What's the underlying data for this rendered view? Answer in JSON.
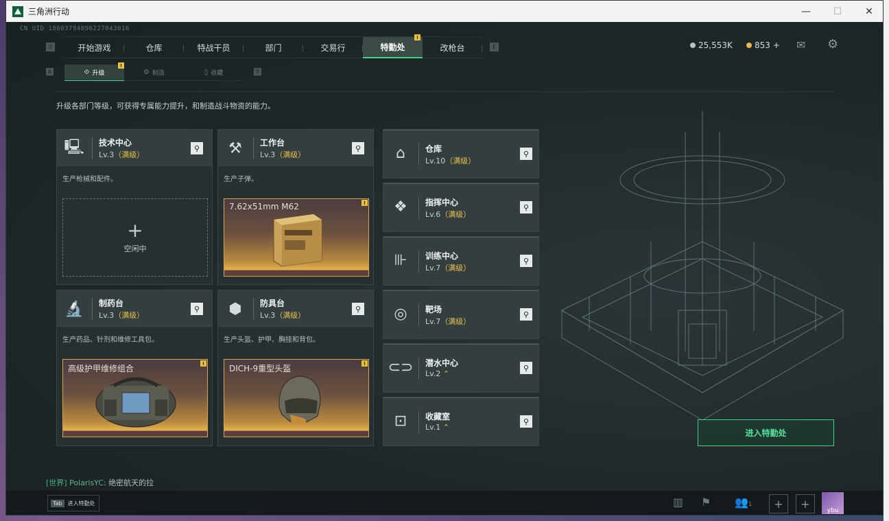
{
  "window": {
    "title": "三角洲行动",
    "min": "—",
    "max": "☐",
    "close": "✕"
  },
  "uid": "CN UID 18603794096227043016",
  "nav": {
    "key_left": "Q",
    "key_right": "E",
    "tabs": [
      "开始游戏",
      "仓库",
      "特战干员",
      "部门",
      "交易行",
      "特勤处",
      "改枪台"
    ],
    "active_badge": "!"
  },
  "currency": {
    "silver": "25,553K",
    "gold": "853 +"
  },
  "subnav": {
    "key_left": "A",
    "key_right": "D",
    "tabs": [
      "升级",
      "制造",
      "收藏"
    ],
    "badge": "!"
  },
  "description": "升级各部门等级，可获得专属能力提升，和制造战斗物资的能力。",
  "cards": [
    {
      "name": "技术中心",
      "lv": "Lv.3",
      "max": "（满级）",
      "desc": "生产枪械和配件。",
      "slot": {
        "type": "empty",
        "plus": "+",
        "label": "空闲中"
      },
      "icon": "computer-icon"
    },
    {
      "name": "工作台",
      "lv": "Lv.3",
      "max": "（满级）",
      "desc": "生产子弹。",
      "slot": {
        "type": "item",
        "label": "7.62x51mm M62",
        "badge": "!"
      },
      "icon": "tools-icon"
    },
    {
      "name": "制药台",
      "lv": "Lv.3",
      "max": "（满级）",
      "desc": "生产药品、针剂和维修工具包。",
      "slot": {
        "type": "item",
        "label": "高级护甲维修组合",
        "badge": "!"
      },
      "icon": "microscope-icon"
    },
    {
      "name": "防具台",
      "lv": "Lv.3",
      "max": "（满级）",
      "desc": "生产头盔、护甲、胸挂和背包。",
      "slot": {
        "type": "item",
        "label": "DICH-9重型头盔",
        "badge": "!"
      },
      "icon": "armor-blocks-icon"
    }
  ],
  "departments": [
    {
      "name": "仓库",
      "lv": "Lv.10",
      "max": "（满级）",
      "icon": "warehouse-icon"
    },
    {
      "name": "指挥中心",
      "lv": "Lv.6",
      "max": "（满级）",
      "icon": "command-icon"
    },
    {
      "name": "训练中心",
      "lv": "Lv.7",
      "max": "（满级）",
      "icon": "dumbbell-icon"
    },
    {
      "name": "靶场",
      "lv": "Lv.7",
      "max": "（满级）",
      "icon": "target-icon"
    },
    {
      "name": "潜水中心",
      "lv": "Lv.2",
      "max": "⌃",
      "icon": "diving-icon"
    },
    {
      "name": "收藏室",
      "lv": "Lv.1",
      "max": "⌃",
      "icon": "collection-icon"
    }
  ],
  "enter_button": "进入特勤处",
  "chat": {
    "channel": "[世界]",
    "name": "PolarisYC:",
    "message": "绝密航天的拉"
  },
  "bottom": {
    "tab_key": "Tab",
    "tab_label": "进入特勤处",
    "party_count": "1",
    "avatar_label": "ybu"
  },
  "colors": {
    "accent": "#3fd48a",
    "gold": "#e5c14b"
  }
}
